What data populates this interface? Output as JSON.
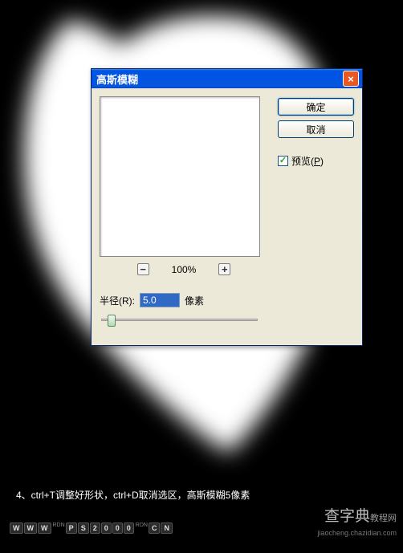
{
  "dialog": {
    "title": "高斯模糊",
    "close_icon": "×",
    "zoom": {
      "out": "−",
      "level": "100%",
      "in": "+"
    },
    "radius": {
      "label": "半径(R):",
      "value": "5.0",
      "unit": "像素"
    },
    "buttons": {
      "ok": "确定",
      "cancel": "取消"
    },
    "preview_check": "✓",
    "preview_label_pre": "预览(",
    "preview_label_key": "P",
    "preview_label_post": ")"
  },
  "instruction": "4、ctrl+T调整好形状，ctrl+D取消选区，高斯模糊5像素",
  "badges": {
    "b1": "W",
    "b2": "W",
    "b3": "W",
    "sub1": "RDN",
    "b4": "P",
    "b5": "S",
    "b6": "2",
    "b7": "0",
    "b8": "0",
    "b9": "0",
    "sub2": "RDN",
    "b10": "C",
    "b11": "N"
  },
  "watermark": {
    "main_a": "查字典",
    "main_b": "教程网",
    "url": "jiaocheng.chazidian.com"
  }
}
